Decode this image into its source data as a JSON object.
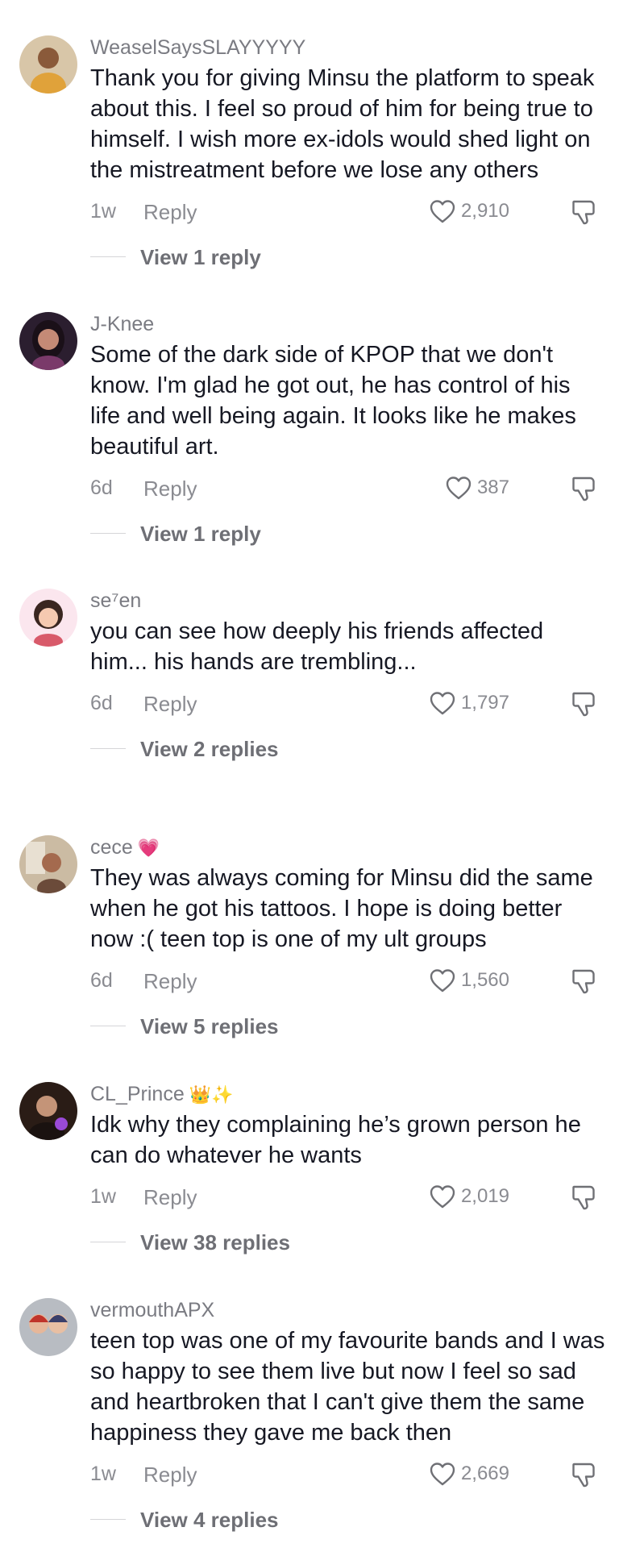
{
  "comments": [
    {
      "username": "WeaselSaysSLAYYYYY",
      "badge": "",
      "text": "Thank you for giving Minsu the platform to speak about this. I feel so proud of him for being true to himself. I wish more ex-idols would shed light on the mistreatment before we lose any others",
      "age": "1w",
      "reply": "Reply",
      "likes": "2,910",
      "view_replies": "View 1 reply",
      "avatar_icon": "user-avatar-icon",
      "avatar_color": "#c9a878"
    },
    {
      "username": "J-Knee",
      "badge": "",
      "text": "Some of the dark side of KPOP that we don't know. I'm glad he got out, he has control of his life and well being again. It looks like he makes beautiful art.",
      "age": "6d",
      "reply": "Reply",
      "likes": "387",
      "view_replies": "View 1 reply",
      "avatar_icon": "user-avatar-icon",
      "avatar_color": "#3a2a3f"
    },
    {
      "username": "se⁷en",
      "badge": "",
      "text": "you can see how deeply his friends affected him... his hands are trembling...",
      "age": "6d",
      "reply": "Reply",
      "likes": "1,797",
      "view_replies": "View 2 replies",
      "avatar_icon": "user-avatar-icon",
      "avatar_color": "#f4d2df"
    },
    {
      "username": "cece",
      "badge": "💗",
      "text": "They was always coming for Minsu did the same when he got his tattoos. I hope is doing better now :( teen top is one of my ult groups",
      "age": "6d",
      "reply": "Reply",
      "likes": "1,560",
      "view_replies": "View 5 replies",
      "avatar_icon": "user-avatar-icon",
      "avatar_color": "#b9a58c"
    },
    {
      "username": "CL_Prince",
      "badge": "👑✨",
      "text": "Idk why they complaining he’s grown person he can do whatever he wants",
      "age": "1w",
      "reply": "Reply",
      "likes": "2,019",
      "view_replies": "View 38 replies",
      "avatar_icon": "user-avatar-icon",
      "avatar_color": "#4a3226"
    },
    {
      "username": "vermouthAPX",
      "badge": "",
      "text": "teen top was one of my favourite bands and I was so happy to see them live but now I feel so sad and heartbroken that I can't give them the same happiness they gave me back then",
      "age": "1w",
      "reply": "Reply",
      "likes": "2,669",
      "view_replies": "View 4 replies",
      "avatar_icon": "user-avatar-icon",
      "avatar_color": "#9aa0a8"
    }
  ],
  "icons": {
    "like": "heart-outline-icon",
    "dislike": "thumbs-down-icon"
  },
  "colors": {
    "text": "#161823",
    "secondary": "#8a8b91"
  }
}
